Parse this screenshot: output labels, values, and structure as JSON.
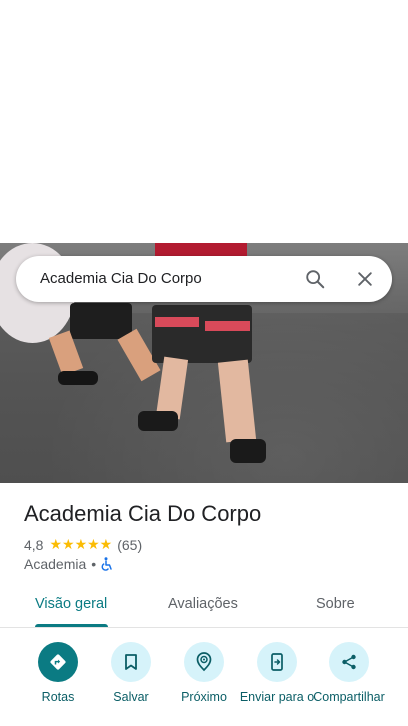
{
  "search": {
    "query": "Academia Cia Do Corpo"
  },
  "place": {
    "title": "Academia Cia Do Corpo",
    "rating": "4,8",
    "stars": "★★★★★",
    "review_count": "(65)",
    "category": "Academia",
    "separator": "•"
  },
  "tabs": [
    {
      "label": "Visão geral"
    },
    {
      "label": "Avaliações"
    },
    {
      "label": "Sobre"
    }
  ],
  "actions": [
    {
      "label": "Rotas",
      "icon": "directions-icon"
    },
    {
      "label": "Salvar",
      "icon": "bookmark-icon"
    },
    {
      "label": "Próximo",
      "icon": "nearby-icon"
    },
    {
      "label": "Enviar para o",
      "icon": "send-to-phone-icon"
    },
    {
      "label": "Compartilhar",
      "icon": "share-icon"
    }
  ],
  "colors": {
    "accent": "#0b7b83",
    "action_bg": "#d6f3fa",
    "star": "#fbbc04"
  }
}
